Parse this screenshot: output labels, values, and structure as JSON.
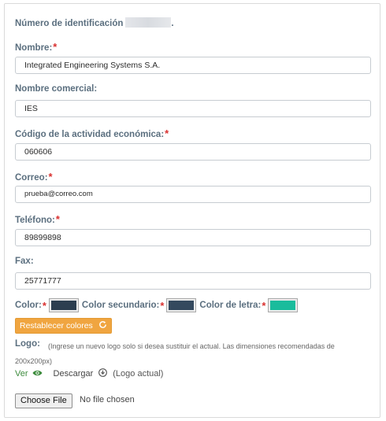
{
  "form": {
    "id_label": "Número de identificación",
    "id_suffix": ".",
    "required_mark": "*",
    "nombre": {
      "label": "Nombre:",
      "value": "Integrated Engineering Systems S.A."
    },
    "nombre_comercial": {
      "label": "Nombre comercial:",
      "value": "IES"
    },
    "actividad": {
      "label": "Código de la actividad económica:",
      "value": "060606"
    },
    "correo": {
      "label": "Correo:",
      "value": "prueba@correo.com"
    },
    "telefono": {
      "label": "Teléfono:",
      "value": "89899898"
    },
    "fax": {
      "label": "Fax:",
      "value": "25771777"
    },
    "colors": {
      "color_label": "Color:",
      "color_value": "#2c3e50",
      "secondary_label": "Color secundario:",
      "secondary_value": "#34495e",
      "text_label": "Color de letra:",
      "text_value": "#1abc9c"
    },
    "reset_button": "Restablecer colores",
    "logo": {
      "label": "Logo:",
      "hint": "(Ingrese un nuevo logo solo si desea sustituir el actual. Las dimensiones recomendadas de 200x200px)",
      "view_link": "Ver",
      "download_link": "Descargar",
      "current_note": "(Logo actual)"
    },
    "file": {
      "button": "Choose File",
      "status": "No file chosen"
    }
  },
  "icons": {
    "required": "asterisk",
    "view": "eye-icon",
    "download": "download-circle-icon",
    "reset": "refresh-icon"
  }
}
